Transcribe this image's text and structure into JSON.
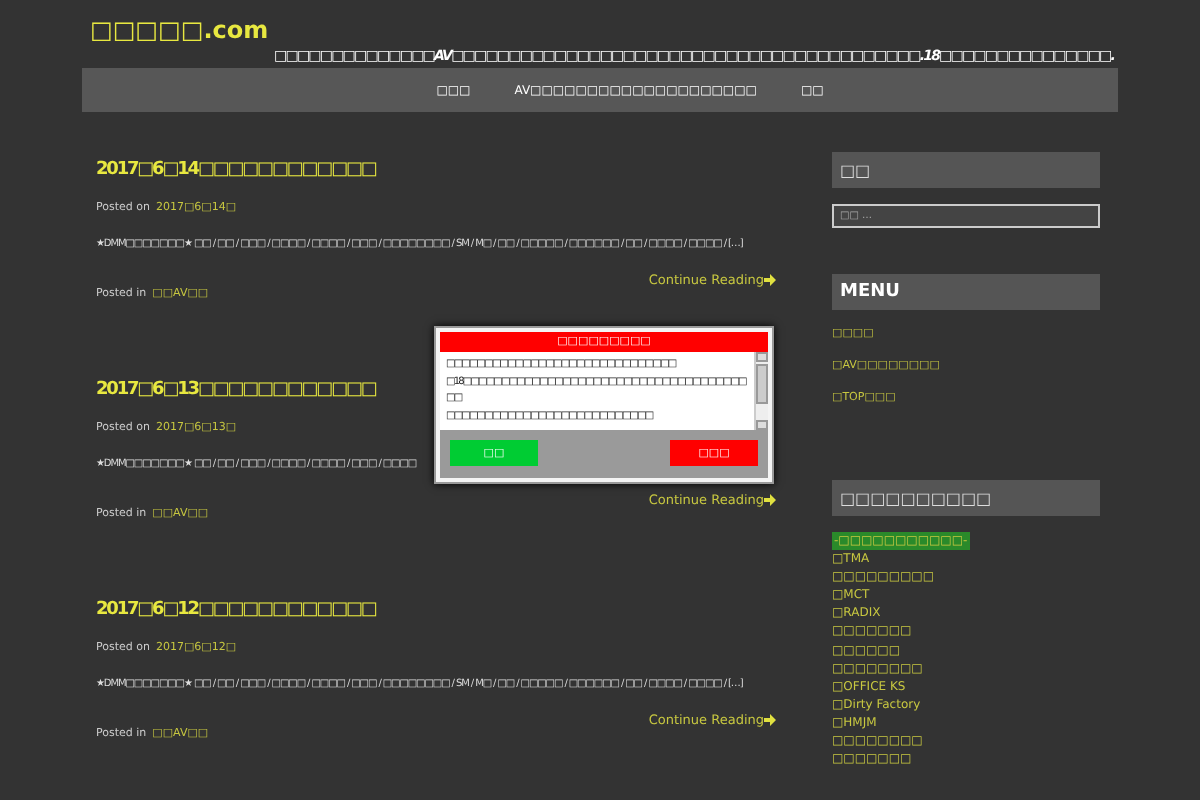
{
  "site": {
    "title": "□□□□□.com",
    "tagline": "□□□□□□□□□□□□□□AV□□□□□□□□□□□□□□□□□□□□□□□□□□□□□□□□□□□□□□□□□.18□□□□□□□□□□□□□□□."
  },
  "nav": [
    {
      "label": "□□□"
    },
    {
      "label": "AV□□□□□□□□□□□□□□□□□□□□"
    },
    {
      "label": "□□"
    }
  ],
  "posts": [
    {
      "title": "2017□6□14□□□□□□□□□□□□",
      "posted_label": "Posted on",
      "date": "2017□6□14□",
      "excerpt": "★DMM□□□□□□□★ □□ / □□ / □□□ / □□□□ / □□□□ / □□□ / □□□□□□□□ / SM / M□ / □□ / □□□□□ / □□□□□□ / □□ / □□□□ / □□□□ / […]",
      "more": "Continue Reading",
      "category_label": "Posted in",
      "category": "□□AV□□"
    },
    {
      "title": "2017□6□13□□□□□□□□□□□□",
      "posted_label": "Posted on",
      "date": "2017□6□13□",
      "excerpt": "★DMM□□□□□□□★ □□ / □□ / □□□ / □□□□ / □□□□ / □□□ / □□□□",
      "more": "Continue Reading",
      "category_label": "Posted in",
      "category": "□□AV□□"
    },
    {
      "title": "2017□6□12□□□□□□□□□□□□",
      "posted_label": "Posted on",
      "date": "2017□6□12□",
      "excerpt": "★DMM□□□□□□□★ □□ / □□ / □□□ / □□□□ / □□□□ / □□□ / □□□□□□□□ / SM / M□ / □□ / □□□□□ / □□□□□□ / □□ / □□□□ / □□□□ / […]",
      "more": "Continue Reading",
      "category_label": "Posted in",
      "category": "□□AV□□"
    }
  ],
  "sidebar": {
    "search": {
      "heading": "□□",
      "placeholder": "□□ …"
    },
    "menu": {
      "heading": "MENU",
      "items": [
        "□□□□",
        "□AV□□□□□□□□",
        "□TOP□□□"
      ]
    },
    "makers": {
      "heading": "□□□□□□□□□□",
      "items": [
        {
          "kind": "heading",
          "label": "-□□□□□□□□□□□-"
        },
        {
          "kind": "link",
          "label": "□TMA"
        },
        {
          "kind": "link",
          "label": "□□□□□□□□□"
        },
        {
          "kind": "link",
          "label": "□MCT"
        },
        {
          "kind": "link",
          "label": "□RADIX"
        },
        {
          "kind": "link",
          "label": "□□□□□□□"
        },
        {
          "kind": "link",
          "label": "□□□□□□"
        },
        {
          "kind": "link",
          "label": "□□□□□□□□"
        },
        {
          "kind": "link",
          "label": "□OFFICE KS"
        },
        {
          "kind": "link",
          "label": "□Dirty Factory"
        },
        {
          "kind": "link",
          "label": "□HMJM"
        },
        {
          "kind": "link",
          "label": "□□□□□□□□"
        },
        {
          "kind": "link",
          "label": "□□□□□□□"
        }
      ]
    }
  },
  "dialog": {
    "title": "□□□□□□□□□",
    "lines": [
      "□□□□□□□□□□□□□□□□□□□□□□□□□□□□□□",
      "□18□□□□□□□□□□□□□□□□□□□□□□□□□□□□□□□□□□□□□",
      "□□",
      "□□□□□□□□□□□□□□□□□□□□□□□□□□□"
    ],
    "accept": "□□",
    "decline": "□□□"
  }
}
